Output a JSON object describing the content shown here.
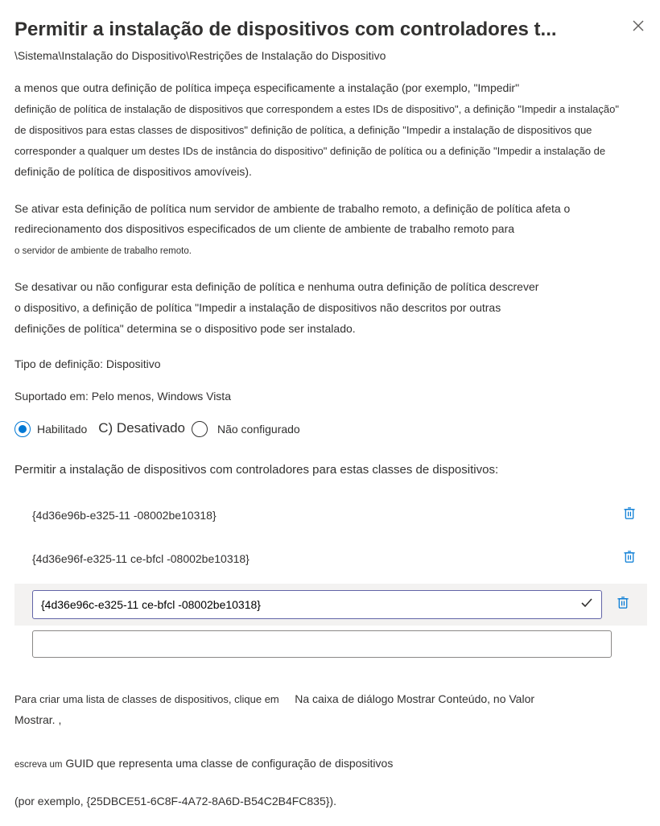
{
  "title": "Permitir a instalação de dispositivos com controladores t...",
  "breadcrumb": "\\Sistema\\Instalação do Dispositivo\\Restrições de Instalação do Dispositivo",
  "desc": {
    "p1_a": "a menos que outra definição de política impeça especificamente a instalação (por exemplo, \"Impedir\"",
    "p1_b": "definição de política de instalação de dispositivos que correspondem a estes IDs de dispositivo\", a definição \"Impedir a instalação\"",
    "p1_c": "de dispositivos para estas classes de dispositivos\" definição de política, a definição \"Impedir a instalação de dispositivos que",
    "p1_d": "corresponder a qualquer um destes IDs de instância do dispositivo\" definição de política ou a definição \"Impedir a instalação de",
    "p1_e": "definição de política de dispositivos amovíveis).",
    "p2_a": "Se ativar esta definição de política num servidor de ambiente de trabalho remoto, a definição de política afeta o",
    "p2_b": "redirecionamento dos dispositivos especificados de um cliente de ambiente de trabalho remoto para",
    "p2_c": "o servidor de ambiente de trabalho remoto.",
    "p3_a": "Se desativar ou não configurar esta definição de política e nenhuma outra definição de política descrever",
    "p3_b": "o dispositivo, a definição de política \"Impedir a instalação de dispositivos não descritos por outras",
    "p3_c": "definições de política\" determina se o dispositivo pode ser instalado."
  },
  "setting_type": "Tipo de definição: Dispositivo",
  "supported": "Suportado em: Pelo menos, Windows Vista",
  "radios": {
    "enabled": "Habilitado",
    "disabled": "C) Desativado",
    "notconfigured": "Não configurado"
  },
  "list_title": "Permitir a instalação de dispositivos com controladores para estas classes de dispositivos:",
  "list": [
    "{4d36e96b-e325-11 -08002be10318}",
    "{4d36e96f-e325-11 ce-bfcl -08002be10318}"
  ],
  "editing_value": "{4d36e96c-e325-11 ce-bfcl -08002be10318}",
  "help": {
    "a1": "Para criar uma lista de classes de dispositivos, clique em",
    "a2": "Na caixa de diálogo Mostrar Conteúdo, no Valor",
    "a3": "Mostrar. ,",
    "b1": "escreva um",
    "b2": "GUID que representa uma classe de configuração de dispositivos",
    "c": "(por exemplo, {25DBCE51-6C8F-4A72-8A6D-B54C2B4FC835})."
  }
}
